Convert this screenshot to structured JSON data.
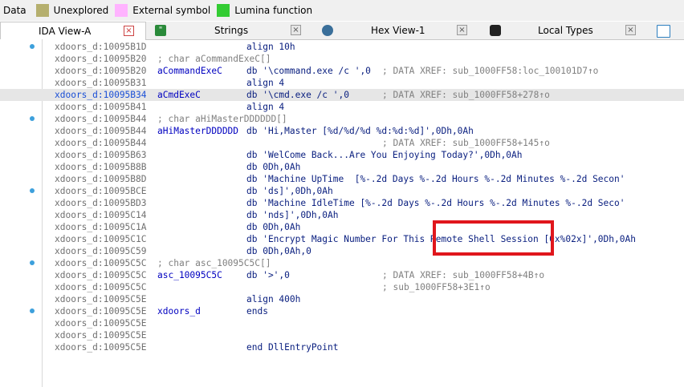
{
  "legend": {
    "items": [
      {
        "label": "Data",
        "color": ""
      },
      {
        "label": "Unexplored",
        "color": "#b5af6e"
      },
      {
        "label": "External symbol",
        "color": "#ffb3ff"
      },
      {
        "label": "Lumina function",
        "color": "#33cc33"
      }
    ]
  },
  "tabs": [
    {
      "label": "IDA View-A",
      "icon": "ida-view-icon",
      "active": true
    },
    {
      "label": "Strings",
      "icon": "strings-icon",
      "active": false
    },
    {
      "label": "Hex View-1",
      "icon": "hex-view-icon",
      "active": false
    },
    {
      "label": "Local Types",
      "icon": "local-types-icon",
      "active": false
    }
  ],
  "close_glyph": "×",
  "listing": [
    {
      "addr": "xdoors_d:10095B1D",
      "ins": "align 10h"
    },
    {
      "addr": "xdoors_d:10095B20",
      "comment": "; char aCommandExeC[]"
    },
    {
      "addr": "xdoors_d:10095B20",
      "label": "aCommandExeC",
      "ops": "db '\\command.exe /c ',0",
      "xref": "; DATA XREF: sub_1000FF58:loc_100101D7↑o"
    },
    {
      "addr": "xdoors_d:10095B31",
      "ins": "align 4"
    },
    {
      "addr": "xdoors_d:10095B34",
      "label": "aCmdExeC",
      "ops": "db '\\cmd.exe /c ',0",
      "xref": "; DATA XREF: sub_1000FF58+278↑o",
      "highlight": true
    },
    {
      "addr": "xdoors_d:10095B41",
      "ins": "align 4"
    },
    {
      "addr": "xdoors_d:10095B44",
      "comment": "; char aHiMasterDDDDDD[]"
    },
    {
      "addr": "xdoors_d:10095B44",
      "label": "aHiMasterDDDDDD",
      "ops": "db 'Hi,Master [%d/%d/%d %d:%d:%d]',0Dh,0Ah"
    },
    {
      "addr": "xdoors_d:10095B44",
      "xref": "; DATA XREF: sub_1000FF58+145↑o"
    },
    {
      "addr": "xdoors_d:10095B63",
      "ops": "db 'WelCome Back...Are You Enjoying Today?',0Dh,0Ah"
    },
    {
      "addr": "xdoors_d:10095B8B",
      "ops": "db 0Dh,0Ah"
    },
    {
      "addr": "xdoors_d:10095B8D",
      "ops": "db 'Machine UpTime  [%-.2d Days %-.2d Hours %-.2d Minutes %-.2d Secon'"
    },
    {
      "addr": "xdoors_d:10095BCE",
      "ops": "db 'ds]',0Dh,0Ah"
    },
    {
      "addr": "xdoors_d:10095BD3",
      "ops": "db 'Machine IdleTime [%-.2d Days %-.2d Hours %-.2d Minutes %-.2d Seco'"
    },
    {
      "addr": "xdoors_d:10095C14",
      "ops": "db 'nds]',0Dh,0Ah"
    },
    {
      "addr": "xdoors_d:10095C1A",
      "ops": "db 0Dh,0Ah"
    },
    {
      "addr": "xdoors_d:10095C1C",
      "ops": "db 'Encrypt Magic Number For This Remote Shell Session [0x%02x]',0Dh,0Ah"
    },
    {
      "addr": "xdoors_d:10095C59",
      "ops": "db 0Dh,0Ah,0"
    },
    {
      "addr": "xdoors_d:10095C5C",
      "comment": "; char asc_10095C5C[]"
    },
    {
      "addr": "xdoors_d:10095C5C",
      "label": "asc_10095C5C",
      "ops": "db '>',0",
      "xref": "; DATA XREF: sub_1000FF58+4B↑o"
    },
    {
      "addr": "xdoors_d:10095C5C",
      "xref": "; sub_1000FF58+3E1↑o"
    },
    {
      "addr": "xdoors_d:10095C5E",
      "ins": "align 400h"
    },
    {
      "addr": "xdoors_d:10095C5E",
      "label": "xdoors_d",
      "ins": "ends"
    },
    {
      "addr": "xdoors_d:10095C5E"
    },
    {
      "addr": "xdoors_d:10095C5E"
    },
    {
      "addr": "xdoors_d:10095C5E",
      "ins": "end DllEntryPoint"
    }
  ],
  "gutter_dots": [
    0,
    4,
    6,
    12,
    18,
    22
  ]
}
